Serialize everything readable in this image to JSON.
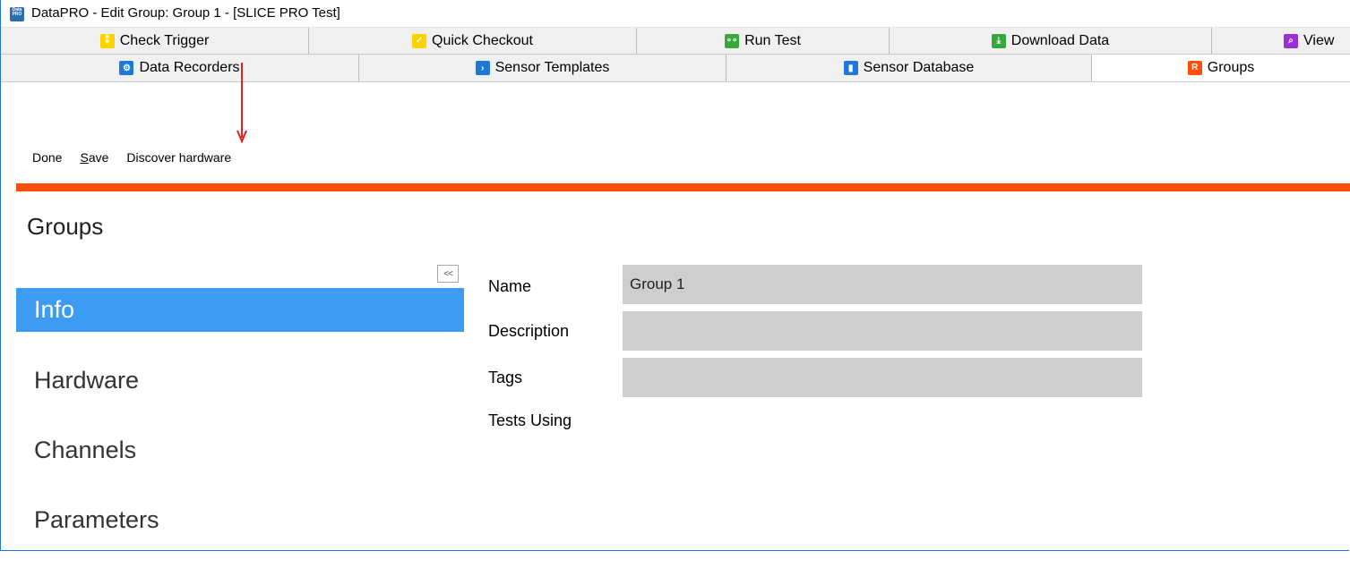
{
  "window": {
    "title": "DataPRO - Edit Group: Group 1  - [SLICE PRO Test]",
    "app_icon_text": "Data PRO"
  },
  "tabs_row1": [
    {
      "label": "Check Trigger",
      "icon": "trigger-icon",
      "color": "#ffd200"
    },
    {
      "label": "Quick Checkout",
      "icon": "checkout-icon",
      "color": "#ffd200"
    },
    {
      "label": "Run Test",
      "icon": "run-icon",
      "color": "#37a83b"
    },
    {
      "label": "Download Data",
      "icon": "download-icon",
      "color": "#37a83b"
    },
    {
      "label": "View",
      "icon": "view-icon",
      "color": "#9b30d9"
    }
  ],
  "tabs_row2": [
    {
      "label": "Data Recorders",
      "icon": "recorder-icon",
      "color": "#1e78d6"
    },
    {
      "label": "Sensor Templates",
      "icon": "template-icon",
      "color": "#1e78d6"
    },
    {
      "label": "Sensor Database",
      "icon": "database-icon",
      "color": "#1e78d6"
    },
    {
      "label": "Groups",
      "icon": "groups-icon",
      "color": "#ff4e0c",
      "active": true
    }
  ],
  "toolbar": {
    "done": "Done",
    "save_prefix": "S",
    "save_rest": "ave",
    "discover": "Discover hardware"
  },
  "section": {
    "title": "Groups",
    "collapse_label": "<<"
  },
  "nav": [
    "Info",
    "Hardware",
    "Channels",
    "Parameters"
  ],
  "form": {
    "name_label": "Name",
    "name_value": "Group 1",
    "description_label": "Description",
    "description_value": "",
    "tags_label": "Tags",
    "tags_value": "",
    "tests_using_label": "Tests Using"
  },
  "colors": {
    "accent_bar": "#ff4e0c",
    "nav_active": "#3d9cf2",
    "annotation_arrow": "#e02020"
  }
}
